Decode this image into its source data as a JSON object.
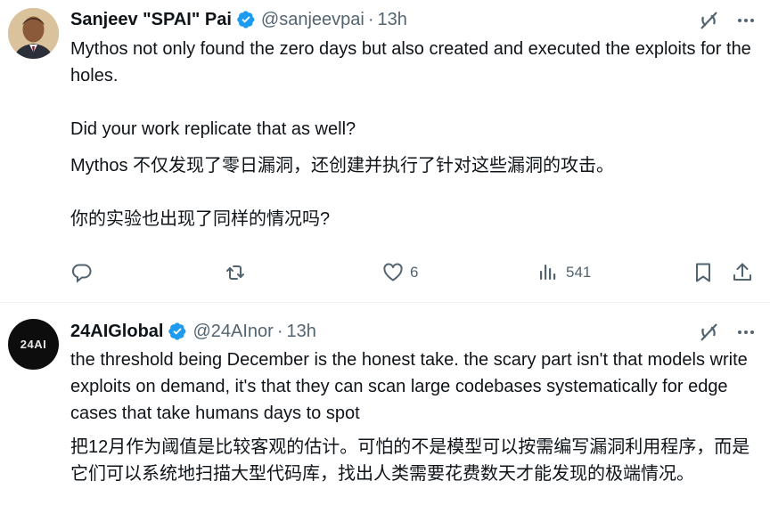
{
  "tweets": [
    {
      "author": {
        "name": "Sanjeev \"SPAI\" Pai",
        "handle": "@sanjeevpai",
        "time": "13h"
      },
      "text_en": [
        "Mythos not only found the zero days but also created and executed the exploits for the holes.",
        "Did your work replicate that as well?"
      ],
      "text_cn": [
        "Mythos 不仅发现了零日漏洞，还创建并执行了针对这些漏洞的攻击。",
        "你的实验也出现了同样的情况吗?"
      ],
      "actions": {
        "replies": "",
        "reposts": "",
        "likes": "6",
        "views": "541"
      }
    },
    {
      "author": {
        "name": "24AIGlobal",
        "handle": "@24AInor",
        "time": "13h",
        "avatar_text": "24AI"
      },
      "text_en": [
        "the threshold being December is the honest take. the scary part isn't that models write exploits on demand, it's that they can scan large codebases systematically for edge cases that take humans days to spot"
      ],
      "text_cn": [
        "把12月作为阈值是比较客观的估计。可怕的不是模型可以按需编写漏洞利用程序，而是它们可以系统地扫描大型代码库，找出人类需要花费数天才能发现的极端情况。"
      ]
    }
  ],
  "colors": {
    "text": "#0f1419",
    "secondary": "#536471",
    "verified": "#1d9bf0",
    "divider": "#eff3f4"
  },
  "icons": [
    "verified-badge-icon",
    "grok-icon",
    "more-icon",
    "reply-icon",
    "repost-icon",
    "like-icon",
    "views-icon",
    "bookmark-icon",
    "share-icon"
  ]
}
